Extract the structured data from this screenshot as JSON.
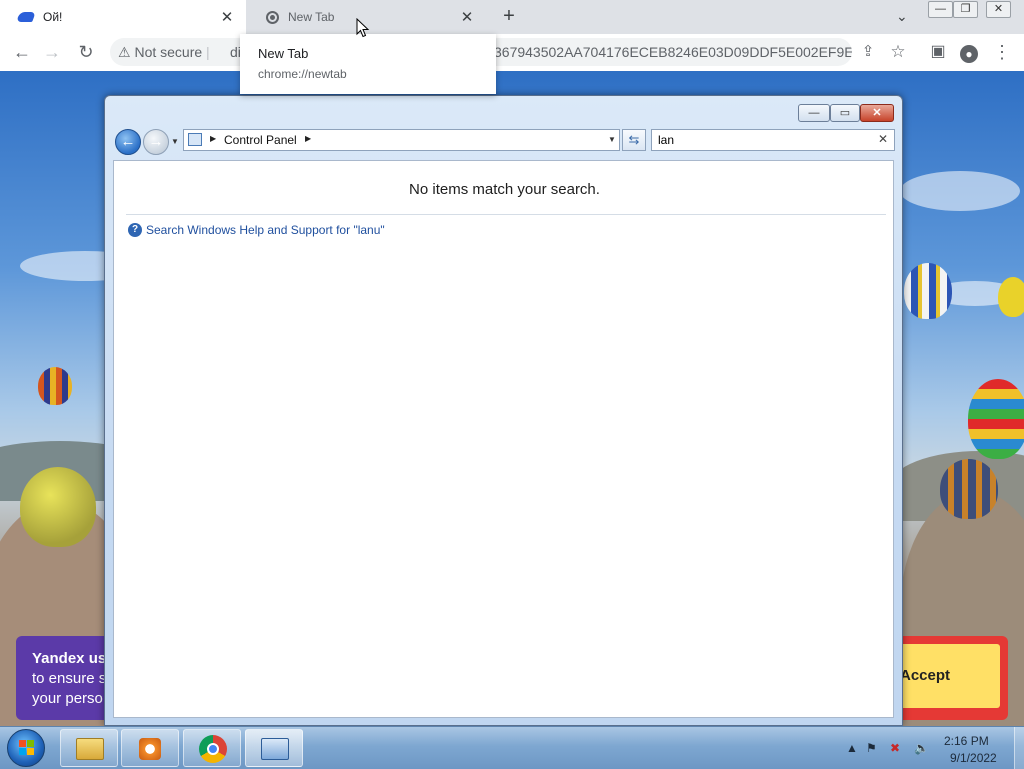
{
  "browser": {
    "tabs": [
      {
        "title": "Ой!",
        "icon": "yandex-icon",
        "active": true
      },
      {
        "title": "New Tab",
        "icon": "chrome-icon",
        "active": false
      }
    ],
    "tooltip": {
      "title": "New Tab",
      "url": "chrome://newtab"
    },
    "address": {
      "security_label": "Not secure",
      "url_start": "di",
      "url_visible_tail": "367943502AA704176ECEB8246E03D09DDF5E002EF9E6..."
    },
    "icons": {
      "back": "back-arrow-icon",
      "forward": "forward-arrow-icon",
      "reload": "reload-icon",
      "share": "share-icon",
      "bookmark": "star-icon",
      "side_panel": "side-panel-icon",
      "profile": "profile-icon",
      "menu": "kebab-menu-icon"
    }
  },
  "page_overlay": {
    "cookie_text_line1": "Yandex us",
    "cookie_text_line2": "to ensure s",
    "cookie_text_line3": "your perso",
    "accept_label": "Accept"
  },
  "control_panel": {
    "address_crumb": "Control Panel",
    "search_value": "lan",
    "no_items_text": "No items match your search.",
    "help_link_text": "Search Windows Help and Support for \"lanu\""
  },
  "taskbar": {
    "items": [
      {
        "name": "windows-explorer",
        "icon": "folder-icon"
      },
      {
        "name": "media-player",
        "icon": "media-player-icon"
      },
      {
        "name": "google-chrome",
        "icon": "chrome-icon"
      },
      {
        "name": "control-panel",
        "icon": "control-panel-icon"
      }
    ],
    "clock_time": "2:16 PM",
    "clock_date": "9/1/2022"
  },
  "colors": {
    "window_frame": "#c6daf2",
    "link_blue": "#1f4f9e",
    "accept_yellow": "#ffe066",
    "cookie_purple": "#5b3aa8"
  }
}
